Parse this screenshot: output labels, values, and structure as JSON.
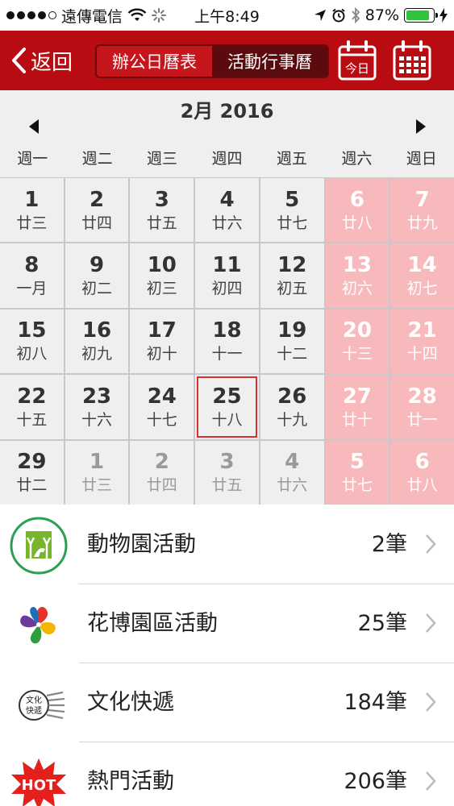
{
  "status_bar": {
    "carrier": "遠傳電信",
    "time": "上午8:49",
    "battery": "87%",
    "battery_level": 0.87,
    "signal_dots": [
      true,
      true,
      true,
      true,
      false
    ]
  },
  "nav": {
    "back_label": "返回",
    "tabs": [
      {
        "label": "辦公日曆表",
        "active": false
      },
      {
        "label": "活動行事曆",
        "active": true
      }
    ],
    "today_icon_text": "今日",
    "brand_color": "#b80b12"
  },
  "calendar": {
    "month_title": "2月 2016",
    "weekdays": [
      "週一",
      "週二",
      "週三",
      "週四",
      "週五",
      "週六",
      "週日"
    ],
    "days": [
      {
        "d": "1",
        "l": "廿三"
      },
      {
        "d": "2",
        "l": "廿四"
      },
      {
        "d": "3",
        "l": "廿五"
      },
      {
        "d": "4",
        "l": "廿六"
      },
      {
        "d": "5",
        "l": "廿七"
      },
      {
        "d": "6",
        "l": "廿八"
      },
      {
        "d": "7",
        "l": "廿九"
      },
      {
        "d": "8",
        "l": "一月"
      },
      {
        "d": "9",
        "l": "初二"
      },
      {
        "d": "10",
        "l": "初三"
      },
      {
        "d": "11",
        "l": "初四"
      },
      {
        "d": "12",
        "l": "初五"
      },
      {
        "d": "13",
        "l": "初六"
      },
      {
        "d": "14",
        "l": "初七"
      },
      {
        "d": "15",
        "l": "初八"
      },
      {
        "d": "16",
        "l": "初九"
      },
      {
        "d": "17",
        "l": "初十"
      },
      {
        "d": "18",
        "l": "十一"
      },
      {
        "d": "19",
        "l": "十二"
      },
      {
        "d": "20",
        "l": "十三"
      },
      {
        "d": "21",
        "l": "十四"
      },
      {
        "d": "22",
        "l": "十五"
      },
      {
        "d": "23",
        "l": "十六"
      },
      {
        "d": "24",
        "l": "十七"
      },
      {
        "d": "25",
        "l": "十八",
        "today": true
      },
      {
        "d": "26",
        "l": "十九"
      },
      {
        "d": "27",
        "l": "廿十"
      },
      {
        "d": "28",
        "l": "廿一"
      },
      {
        "d": "29",
        "l": "廿二"
      },
      {
        "d": "1",
        "l": "廿三",
        "other": true
      },
      {
        "d": "2",
        "l": "廿四",
        "other": true
      },
      {
        "d": "3",
        "l": "廿五",
        "other": true
      },
      {
        "d": "4",
        "l": "廿六",
        "other": true
      },
      {
        "d": "5",
        "l": "廿七",
        "other": true
      },
      {
        "d": "6",
        "l": "廿八",
        "other": true
      }
    ],
    "weekend_color": "#f7b9bb",
    "today_border_color": "#d63236"
  },
  "categories": [
    {
      "label": "動物園活動",
      "count": "2筆",
      "icon": "zoo-icon"
    },
    {
      "label": "花博園區活動",
      "count": "25筆",
      "icon": "flora-expo-icon"
    },
    {
      "label": "文化快遞",
      "count": "184筆",
      "icon": "culture-express-icon",
      "icon_text": "文化快遞"
    },
    {
      "label": "熱門活動",
      "count": "206筆",
      "icon": "hot-icon",
      "icon_text": "HOT"
    }
  ]
}
